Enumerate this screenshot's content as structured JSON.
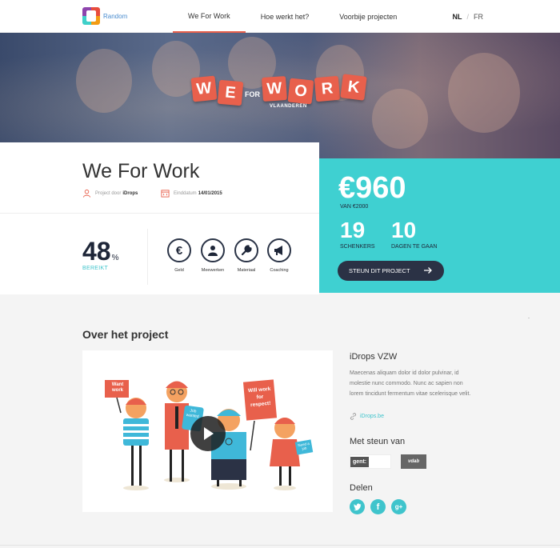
{
  "header": {
    "logo_text": "Random",
    "nav": [
      {
        "label": "We For Work",
        "active": true
      },
      {
        "label": "Hoe werkt het?",
        "active": false
      },
      {
        "label": "Voorbije projecten",
        "active": false
      }
    ],
    "lang": {
      "active": "NL",
      "separator": "/",
      "other": "FR"
    }
  },
  "hero": {
    "logo_letters": [
      "W",
      "E",
      "W",
      "O",
      "R",
      "K"
    ],
    "logo_for": "FOR",
    "logo_sub": "VLAANDEREN",
    "colors": {
      "tile": "#e8604c"
    }
  },
  "project": {
    "title": "We For Work",
    "by_label": "Project door",
    "by_name": "iDrops",
    "deadline_label": "Einddatum",
    "deadline": "14/01/2015",
    "percent": "48",
    "percent_sign": "%",
    "percent_label": "BEREIKT",
    "support_types": [
      {
        "label": "Geld",
        "icon": "euro-icon"
      },
      {
        "label": "Meewerken",
        "icon": "person-icon"
      },
      {
        "label": "Materiaal",
        "icon": "wrench-icon"
      },
      {
        "label": "Coaching",
        "icon": "megaphone-icon"
      }
    ]
  },
  "funding": {
    "amount": "€960",
    "of_goal": "VAN €2000",
    "donors_count": "19",
    "donors_label": "SCHENKERS",
    "days_count": "10",
    "days_label": "DAGEN TE GAAN",
    "cta_label": "STEUN DIT PROJECT",
    "colors": {
      "panel": "#3fd0d1",
      "button": "#2b3245"
    }
  },
  "about": {
    "section_title": "Over het project",
    "org_name": "iDrops VZW",
    "org_description": "Maecenas aliquam dolor id dolor pulvinar, id molestie nunc commodo. Nunc ac sapien non lorem tincidunt fermentum vitae scelerisque velit.",
    "org_link": "iDrops.be",
    "sponsors_title": "Met steun van",
    "sponsors": [
      "gent:",
      "vdab"
    ],
    "share_title": "Delen",
    "share_icons": [
      "twitter-icon",
      "facebook-icon",
      "google-plus-icon"
    ],
    "video_signs": [
      "Want work",
      "Job wanted",
      "Will work for respect!",
      "Need a job"
    ]
  }
}
